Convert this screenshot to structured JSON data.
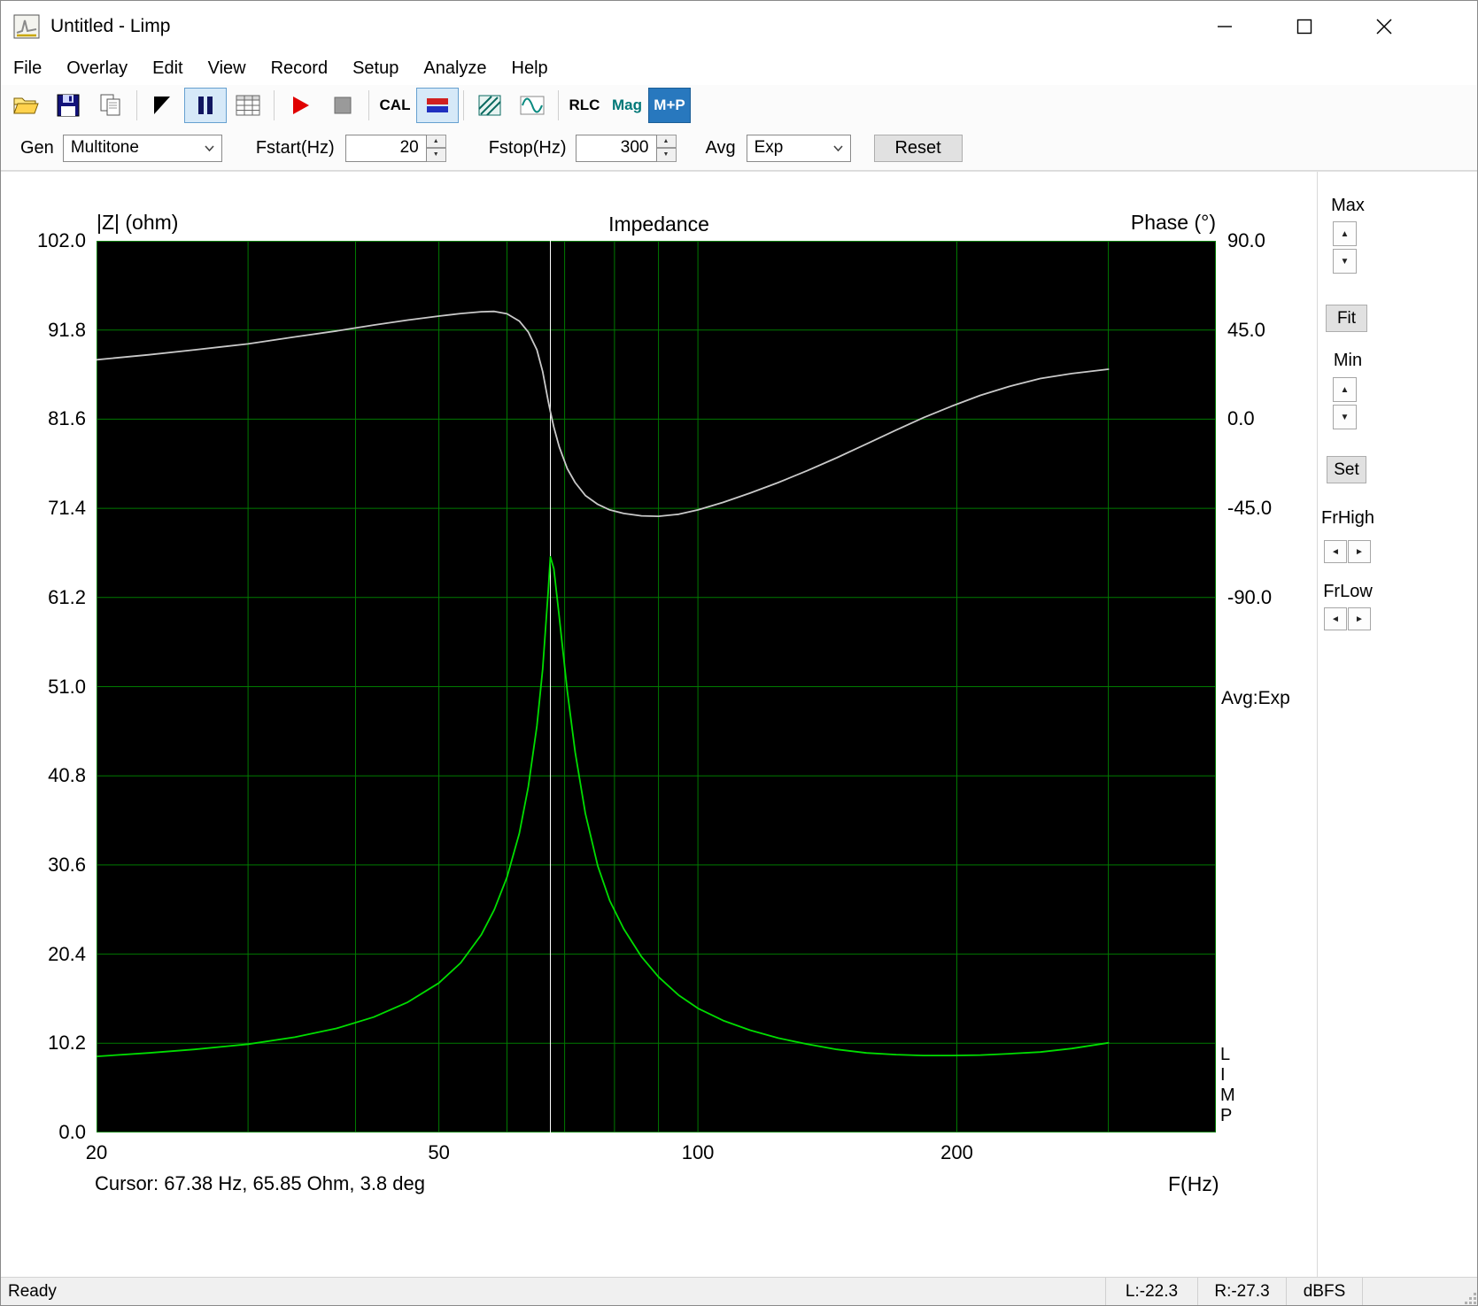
{
  "window": {
    "title": "Untitled - Limp"
  },
  "menu": {
    "items": [
      "File",
      "Overlay",
      "Edit",
      "View",
      "Record",
      "Setup",
      "Analyze",
      "Help"
    ]
  },
  "toolbar": {
    "cal": "CAL",
    "rlc": "RLC",
    "mag": "Mag",
    "mp": "M+P"
  },
  "controls": {
    "gen_label": "Gen",
    "gen_value": "Multitone",
    "fstart_label": "Fstart(Hz)",
    "fstart_value": "20",
    "fstop_label": "Fstop(Hz)",
    "fstop_value": "300",
    "avg_label": "Avg",
    "avg_value": "Exp",
    "reset_label": "Reset"
  },
  "chart": {
    "title": "Impedance",
    "left_axis_title": "|Z| (ohm)",
    "right_axis_title": "Phase (°)",
    "x_axis_title": "F(Hz)",
    "avg_indicator": "Avg:Exp",
    "cursor_readout": "Cursor: 67.38 Hz, 65.85 Ohm, 3.8 deg",
    "watermark": [
      "L",
      "I",
      "M",
      "P"
    ]
  },
  "chart_data": {
    "type": "line",
    "title": "Impedance",
    "x_scale": "log",
    "x_range": [
      20,
      400
    ],
    "x_tick_labels": [
      "20",
      "50",
      "100",
      "200"
    ],
    "x_gridlines": [
      30,
      40,
      50,
      60,
      70,
      80,
      90,
      100,
      200,
      300
    ],
    "left_axis": {
      "label": "|Z| (ohm)",
      "range": [
        0,
        102
      ],
      "tick_labels": [
        "102.0",
        "91.8",
        "81.6",
        "71.4",
        "61.2",
        "51.0",
        "40.8",
        "30.6",
        "20.4",
        "10.2",
        "0.0"
      ]
    },
    "right_axis": {
      "label": "Phase (°)",
      "tick_labels": [
        "90.0",
        "45.0",
        "0.0",
        "-45.0",
        "-90.0"
      ],
      "degrees_per_division": 45,
      "top_degrees": 90
    },
    "cursor": {
      "freq_hz": 67.38,
      "impedance_ohm": 65.85,
      "phase_deg": 3.8
    },
    "colors": {
      "background": "#000000",
      "grid": "#007a00",
      "impedance": "#00dd00",
      "phase": "#c9c9c9",
      "cursor": "#ffffff"
    },
    "series": [
      {
        "name": "impedance_ohm",
        "color": "#00dd00",
        "points": [
          [
            20,
            8.7
          ],
          [
            23,
            9.1
          ],
          [
            26,
            9.5
          ],
          [
            30,
            10.1
          ],
          [
            34,
            10.9
          ],
          [
            38,
            11.9
          ],
          [
            42,
            13.2
          ],
          [
            46,
            14.9
          ],
          [
            50,
            17.1
          ],
          [
            53,
            19.4
          ],
          [
            56,
            22.6
          ],
          [
            58,
            25.5
          ],
          [
            60,
            29.2
          ],
          [
            62,
            34.2
          ],
          [
            63.5,
            39.5
          ],
          [
            65,
            46.5
          ],
          [
            66,
            53
          ],
          [
            67,
            62
          ],
          [
            67.38,
            65.85
          ],
          [
            68,
            64.5
          ],
          [
            69,
            59
          ],
          [
            70.5,
            50.5
          ],
          [
            72,
            43.5
          ],
          [
            74,
            36.5
          ],
          [
            76.5,
            30.5
          ],
          [
            79,
            26.5
          ],
          [
            82,
            23.3
          ],
          [
            86,
            20.1
          ],
          [
            90,
            17.8
          ],
          [
            95,
            15.7
          ],
          [
            100,
            14.2
          ],
          [
            107,
            12.8
          ],
          [
            115,
            11.7
          ],
          [
            124,
            10.8
          ],
          [
            134,
            10.1
          ],
          [
            145,
            9.5
          ],
          [
            157,
            9.1
          ],
          [
            170,
            8.9
          ],
          [
            183,
            8.8
          ],
          [
            197,
            8.8
          ],
          [
            213,
            8.85
          ],
          [
            230,
            9.0
          ],
          [
            250,
            9.2
          ],
          [
            272,
            9.6
          ],
          [
            300,
            10.25
          ]
        ]
      },
      {
        "name": "phase_deg",
        "color": "#c9c9c9",
        "points": [
          [
            20,
            30
          ],
          [
            23,
            32.5
          ],
          [
            26,
            35
          ],
          [
            30,
            38
          ],
          [
            34,
            41.5
          ],
          [
            38,
            44.5
          ],
          [
            42,
            47.5
          ],
          [
            46,
            50
          ],
          [
            50,
            52
          ],
          [
            53,
            53.3
          ],
          [
            56,
            54.2
          ],
          [
            58,
            54.4
          ],
          [
            60,
            53.2
          ],
          [
            62,
            49.5
          ],
          [
            63.5,
            44
          ],
          [
            65,
            35
          ],
          [
            66,
            24
          ],
          [
            67,
            9
          ],
          [
            67.38,
            3.8
          ],
          [
            68,
            -4
          ],
          [
            69,
            -14
          ],
          [
            70.5,
            -25
          ],
          [
            72,
            -32
          ],
          [
            74,
            -38.5
          ],
          [
            76.5,
            -43
          ],
          [
            79,
            -45.8
          ],
          [
            82,
            -47.6
          ],
          [
            86,
            -48.8
          ],
          [
            90,
            -49
          ],
          [
            95,
            -48
          ],
          [
            100,
            -45.8
          ],
          [
            107,
            -42
          ],
          [
            115,
            -37.3
          ],
          [
            124,
            -32
          ],
          [
            134,
            -26
          ],
          [
            145,
            -19.5
          ],
          [
            157,
            -12.5
          ],
          [
            170,
            -5.5
          ],
          [
            183,
            0.8
          ],
          [
            197,
            6.5
          ],
          [
            213,
            12
          ],
          [
            230,
            16.5
          ],
          [
            250,
            20.5
          ],
          [
            272,
            23
          ],
          [
            300,
            25.2
          ]
        ]
      }
    ]
  },
  "side_panel": {
    "max_label": "Max",
    "fit_label": "Fit",
    "min_label": "Min",
    "set_label": "Set",
    "frhigh_label": "FrHigh",
    "frlow_label": "FrLow"
  },
  "status_bar": {
    "ready": "Ready",
    "left_level": "L:-22.3",
    "right_level": "R:-27.3",
    "unit": "dBFS"
  }
}
